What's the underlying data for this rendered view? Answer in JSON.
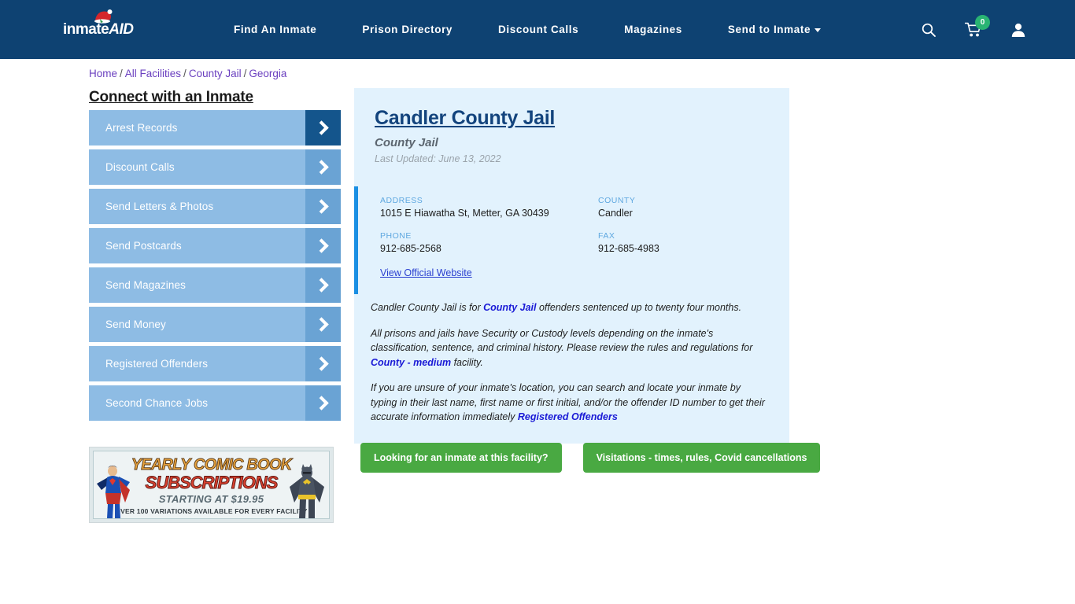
{
  "header": {
    "logo": {
      "part1": "inmate",
      "part2": "AID",
      "hat_icon": "santa-hat-icon"
    },
    "nav": [
      {
        "label": "Find An Inmate",
        "dropdown": false
      },
      {
        "label": "Prison Directory",
        "dropdown": false
      },
      {
        "label": "Discount Calls",
        "dropdown": false
      },
      {
        "label": "Magazines",
        "dropdown": false
      },
      {
        "label": "Send to Inmate",
        "dropdown": true
      }
    ],
    "icons": {
      "search": "search-icon",
      "cart": "shopping-cart-icon",
      "cart_count": "0",
      "account": "user-account-icon"
    },
    "bg_color": "#0e4272",
    "badge_color": "#29b473"
  },
  "breadcrumb": {
    "separator": "/",
    "items": [
      {
        "label": "Home"
      },
      {
        "label": "All Facilities"
      },
      {
        "label": "County Jail"
      },
      {
        "label": "Georgia"
      }
    ],
    "link_color": "#6a3fbf"
  },
  "sidebar": {
    "title": "Connect with an Inmate",
    "items": [
      {
        "label": "Arrest Records",
        "active": true
      },
      {
        "label": "Discount Calls",
        "active": false
      },
      {
        "label": "Send Letters & Photos",
        "active": false
      },
      {
        "label": "Send Postcards",
        "active": false
      },
      {
        "label": "Send Magazines",
        "active": false
      },
      {
        "label": "Send Money",
        "active": false
      },
      {
        "label": "Registered Offenders",
        "active": false
      },
      {
        "label": "Second Chance Jobs",
        "active": false
      }
    ],
    "arrow_icon": "chevron-right-icon",
    "bg_color": "#8ebce4",
    "active_arrow_color": "#14558c"
  },
  "ad": {
    "line1": "YEARLY COMIC BOOK",
    "line2": "SUBSCRIPTIONS",
    "line3": "STARTING AT $19.95",
    "line4": "OVER 100 VARIATIONS AVAILABLE FOR EVERY FACILITY",
    "left_figure": "superman-figure-icon",
    "right_figure": "batman-figure-icon"
  },
  "facility": {
    "title": "Candler County Jail",
    "subtitle": "County Jail",
    "last_updated": "Last Updated: June 13, 2022",
    "details": [
      {
        "label": "ADDRESS",
        "value": "1015 E Hiawatha St, Metter, GA 30439"
      },
      {
        "label": "COUNTY",
        "value": "Candler"
      },
      {
        "label": "PHONE",
        "value": "912-685-2568"
      },
      {
        "label": "FAX",
        "value": "912-685-4983"
      }
    ],
    "official_website": "View Official Website",
    "accent_color": "#1a8fe3",
    "card_bg": "#e2f2fd"
  },
  "description": {
    "p1_a": "Candler County Jail is for ",
    "p1_link": "County Jail",
    "p1_b": " offenders sentenced up to twenty four months.",
    "p2_a": "All prisons and jails have Security or Custody levels depending on the inmate's classification, sentence, and criminal history. Please review the rules and regulations for ",
    "p2_link": "County - medium",
    "p2_b": " facility.",
    "p3_a": "If you are unsure of your inmate's location, you can search and locate your inmate by typing in their last name, first name or first initial, and/or the offender ID number to get their accurate information immediately ",
    "p3_link": "Registered Offenders"
  },
  "cta": {
    "button1": "Looking for an inmate at this facility?",
    "button2": "Visitations - times, rules, Covid cancellations",
    "color": "#49a942"
  }
}
